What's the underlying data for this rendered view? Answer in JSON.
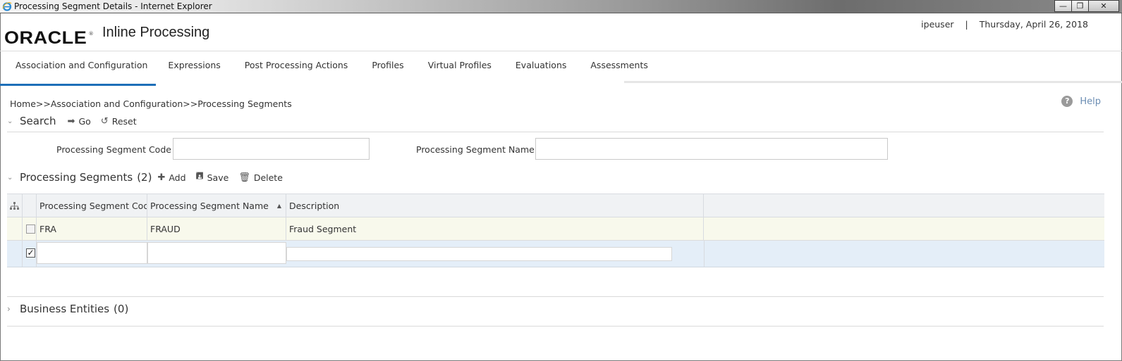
{
  "window": {
    "title": "Processing Segment Details - Internet Explorer",
    "buttons": {
      "minimize": "—",
      "maximize": "❐",
      "close": "✕"
    }
  },
  "header": {
    "logo": "ORACLE",
    "app_name": "Inline Processing",
    "user": "ipeuser",
    "separator": "|",
    "date": "Thursday, April 26, 2018"
  },
  "tabs": [
    {
      "label": "Association and Configuration",
      "active": true
    },
    {
      "label": "Expressions"
    },
    {
      "label": "Post Processing Actions"
    },
    {
      "label": "Profiles"
    },
    {
      "label": "Virtual Profiles"
    },
    {
      "label": "Evaluations"
    },
    {
      "label": "Assessments"
    }
  ],
  "breadcrumb": "Home>>Association and Configuration>>Processing Segments",
  "help_label": "Help",
  "search": {
    "title": "Search",
    "go_label": "Go",
    "reset_label": "Reset",
    "code_label": "Processing Segment Code",
    "code_value": "",
    "name_label": "Processing Segment Name",
    "name_value": ""
  },
  "segments": {
    "title": "Processing Segments",
    "count": "(2)",
    "add_label": "Add",
    "save_label": "Save",
    "delete_label": "Delete",
    "columns": [
      "Processing Segment Code",
      "Processing Segment Name",
      "Description"
    ],
    "rows": [
      {
        "code": "FRA",
        "name": "FRAUD",
        "description": "Fraud Segment",
        "checked": false
      },
      {
        "code": "",
        "name": "",
        "description": "",
        "checked": true
      }
    ]
  },
  "business_entities": {
    "title": "Business Entities",
    "count": "(0)"
  },
  "colors": {
    "accent": "#1d6fb8",
    "row_highlight": "#e4eef8",
    "row_alt": "#f8f9ec",
    "help": "#6b8db3"
  }
}
